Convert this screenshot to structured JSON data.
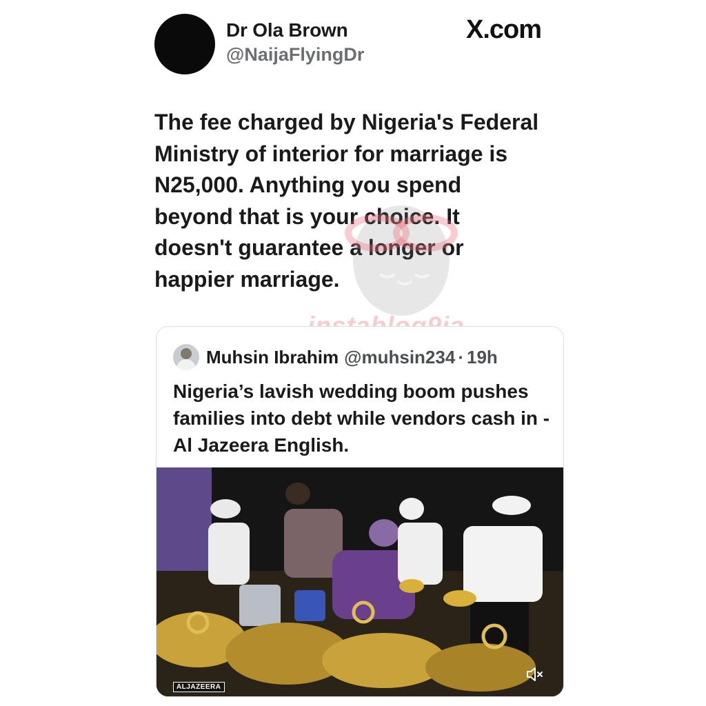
{
  "author": {
    "name": "Dr Ola Brown",
    "handle": "@NaijaFlyingDr"
  },
  "brand": "X.com",
  "post_text": "The fee charged by Nigeria's Federal\nMinistry of interior for marriage is\nN25,000. Anything you spend\nbeyond that is your choice.  It\ndoesn't guarantee a longer or\nhappier marriage.",
  "watermark": "instablog9ja",
  "quoted_post": {
    "author_name": "Muhsin Ibrahim",
    "author_handle": "@muhsin234",
    "separator": "·",
    "time": "19h",
    "text": "Nigeria’s lavish wedding boom pushes families into debt while vendors cash in - Al Jazeera English.",
    "media": {
      "badge": "ALJAZEERA",
      "mute_icon": "speaker-muted-icon",
      "colors": {
        "curtain": "#151515",
        "gold": "#c9a23a",
        "purple": "#6a3f8c"
      }
    }
  }
}
